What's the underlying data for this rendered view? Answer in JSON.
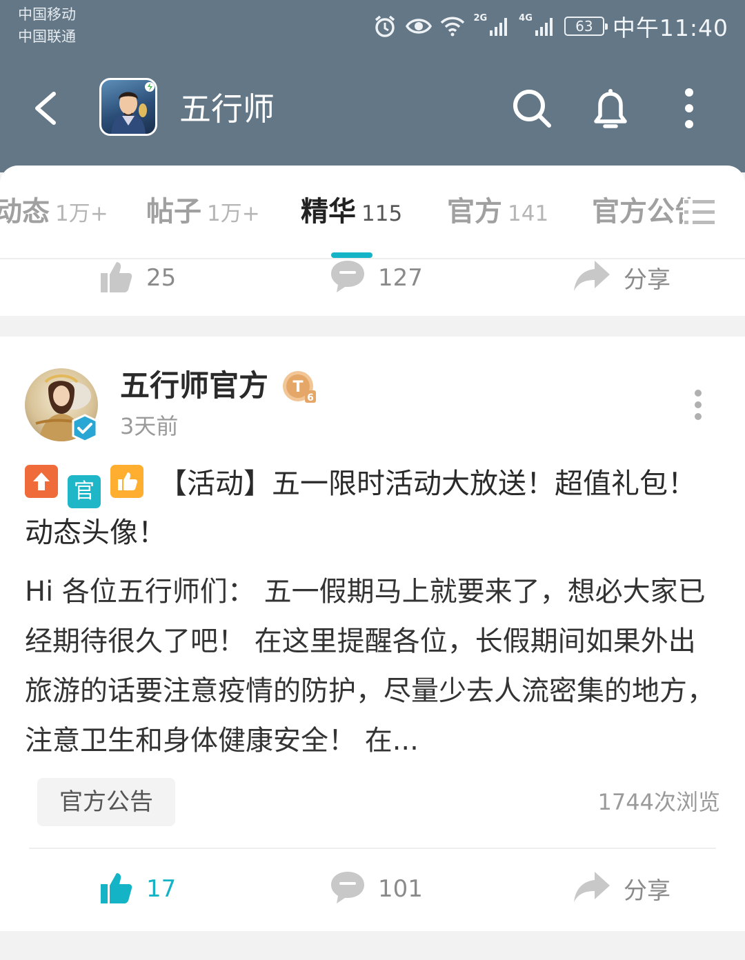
{
  "status_bar": {
    "carrier_1": "中国移动",
    "carrier_2": "中国联通",
    "network_1": "2G",
    "network_2": "4G",
    "battery": "63",
    "time": "中午11:40"
  },
  "header": {
    "title": "五行师",
    "icons": [
      "back-icon",
      "app-icon",
      "search-icon",
      "bell-icon",
      "more-icon"
    ]
  },
  "tabs": [
    {
      "name": "动态",
      "count": "1万+"
    },
    {
      "name": "帖子",
      "count": "1万+"
    },
    {
      "name": "精华",
      "count": "115",
      "active": true
    },
    {
      "name": "官方",
      "count": "141"
    },
    {
      "name": "官方公告",
      "count": ""
    }
  ],
  "prev_post": {
    "likes": "25",
    "comments": "127",
    "share": "分享"
  },
  "post": {
    "author": "五行师官方",
    "level": "T6",
    "time": "3天前",
    "tag_official": "官",
    "title": "【活动】五一限时活动大放送！超值礼包！动态头像！",
    "content": "Hi 各位五行师们： 五一假期马上就要来了，想必大家已经期待很久了吧！ 在这里提醒各位，长假期间如果外出旅游的话要注意疫情的防护，尽量少去人流密集的地方，注意卫生和身体健康安全！ 在...",
    "category": "官方公告",
    "views": "1744次浏览",
    "likes": "17",
    "comments": "101",
    "share": "分享"
  },
  "colors": {
    "header_bg": "#647786",
    "accent": "#14b3c6",
    "tag_up": "#f06b3a",
    "tag_official": "#1fb6c7",
    "tag_good": "#ffae2f"
  }
}
